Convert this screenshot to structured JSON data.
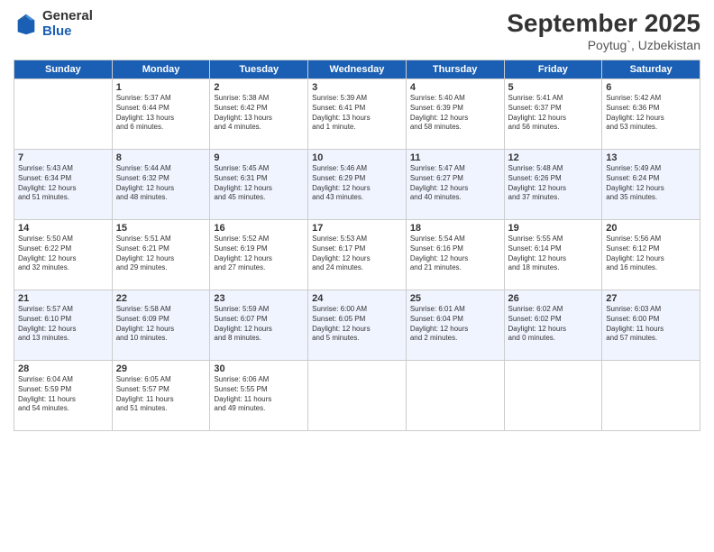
{
  "header": {
    "logo_general": "General",
    "logo_blue": "Blue",
    "month_title": "September 2025",
    "location": "Poytug`, Uzbekistan"
  },
  "days_of_week": [
    "Sunday",
    "Monday",
    "Tuesday",
    "Wednesday",
    "Thursday",
    "Friday",
    "Saturday"
  ],
  "weeks": [
    [
      {
        "day": "",
        "info": ""
      },
      {
        "day": "1",
        "info": "Sunrise: 5:37 AM\nSunset: 6:44 PM\nDaylight: 13 hours\nand 6 minutes."
      },
      {
        "day": "2",
        "info": "Sunrise: 5:38 AM\nSunset: 6:42 PM\nDaylight: 13 hours\nand 4 minutes."
      },
      {
        "day": "3",
        "info": "Sunrise: 5:39 AM\nSunset: 6:41 PM\nDaylight: 13 hours\nand 1 minute."
      },
      {
        "day": "4",
        "info": "Sunrise: 5:40 AM\nSunset: 6:39 PM\nDaylight: 12 hours\nand 58 minutes."
      },
      {
        "day": "5",
        "info": "Sunrise: 5:41 AM\nSunset: 6:37 PM\nDaylight: 12 hours\nand 56 minutes."
      },
      {
        "day": "6",
        "info": "Sunrise: 5:42 AM\nSunset: 6:36 PM\nDaylight: 12 hours\nand 53 minutes."
      }
    ],
    [
      {
        "day": "7",
        "info": "Sunrise: 5:43 AM\nSunset: 6:34 PM\nDaylight: 12 hours\nand 51 minutes."
      },
      {
        "day": "8",
        "info": "Sunrise: 5:44 AM\nSunset: 6:32 PM\nDaylight: 12 hours\nand 48 minutes."
      },
      {
        "day": "9",
        "info": "Sunrise: 5:45 AM\nSunset: 6:31 PM\nDaylight: 12 hours\nand 45 minutes."
      },
      {
        "day": "10",
        "info": "Sunrise: 5:46 AM\nSunset: 6:29 PM\nDaylight: 12 hours\nand 43 minutes."
      },
      {
        "day": "11",
        "info": "Sunrise: 5:47 AM\nSunset: 6:27 PM\nDaylight: 12 hours\nand 40 minutes."
      },
      {
        "day": "12",
        "info": "Sunrise: 5:48 AM\nSunset: 6:26 PM\nDaylight: 12 hours\nand 37 minutes."
      },
      {
        "day": "13",
        "info": "Sunrise: 5:49 AM\nSunset: 6:24 PM\nDaylight: 12 hours\nand 35 minutes."
      }
    ],
    [
      {
        "day": "14",
        "info": "Sunrise: 5:50 AM\nSunset: 6:22 PM\nDaylight: 12 hours\nand 32 minutes."
      },
      {
        "day": "15",
        "info": "Sunrise: 5:51 AM\nSunset: 6:21 PM\nDaylight: 12 hours\nand 29 minutes."
      },
      {
        "day": "16",
        "info": "Sunrise: 5:52 AM\nSunset: 6:19 PM\nDaylight: 12 hours\nand 27 minutes."
      },
      {
        "day": "17",
        "info": "Sunrise: 5:53 AM\nSunset: 6:17 PM\nDaylight: 12 hours\nand 24 minutes."
      },
      {
        "day": "18",
        "info": "Sunrise: 5:54 AM\nSunset: 6:16 PM\nDaylight: 12 hours\nand 21 minutes."
      },
      {
        "day": "19",
        "info": "Sunrise: 5:55 AM\nSunset: 6:14 PM\nDaylight: 12 hours\nand 18 minutes."
      },
      {
        "day": "20",
        "info": "Sunrise: 5:56 AM\nSunset: 6:12 PM\nDaylight: 12 hours\nand 16 minutes."
      }
    ],
    [
      {
        "day": "21",
        "info": "Sunrise: 5:57 AM\nSunset: 6:10 PM\nDaylight: 12 hours\nand 13 minutes."
      },
      {
        "day": "22",
        "info": "Sunrise: 5:58 AM\nSunset: 6:09 PM\nDaylight: 12 hours\nand 10 minutes."
      },
      {
        "day": "23",
        "info": "Sunrise: 5:59 AM\nSunset: 6:07 PM\nDaylight: 12 hours\nand 8 minutes."
      },
      {
        "day": "24",
        "info": "Sunrise: 6:00 AM\nSunset: 6:05 PM\nDaylight: 12 hours\nand 5 minutes."
      },
      {
        "day": "25",
        "info": "Sunrise: 6:01 AM\nSunset: 6:04 PM\nDaylight: 12 hours\nand 2 minutes."
      },
      {
        "day": "26",
        "info": "Sunrise: 6:02 AM\nSunset: 6:02 PM\nDaylight: 12 hours\nand 0 minutes."
      },
      {
        "day": "27",
        "info": "Sunrise: 6:03 AM\nSunset: 6:00 PM\nDaylight: 11 hours\nand 57 minutes."
      }
    ],
    [
      {
        "day": "28",
        "info": "Sunrise: 6:04 AM\nSunset: 5:59 PM\nDaylight: 11 hours\nand 54 minutes."
      },
      {
        "day": "29",
        "info": "Sunrise: 6:05 AM\nSunset: 5:57 PM\nDaylight: 11 hours\nand 51 minutes."
      },
      {
        "day": "30",
        "info": "Sunrise: 6:06 AM\nSunset: 5:55 PM\nDaylight: 11 hours\nand 49 minutes."
      },
      {
        "day": "",
        "info": ""
      },
      {
        "day": "",
        "info": ""
      },
      {
        "day": "",
        "info": ""
      },
      {
        "day": "",
        "info": ""
      }
    ]
  ]
}
